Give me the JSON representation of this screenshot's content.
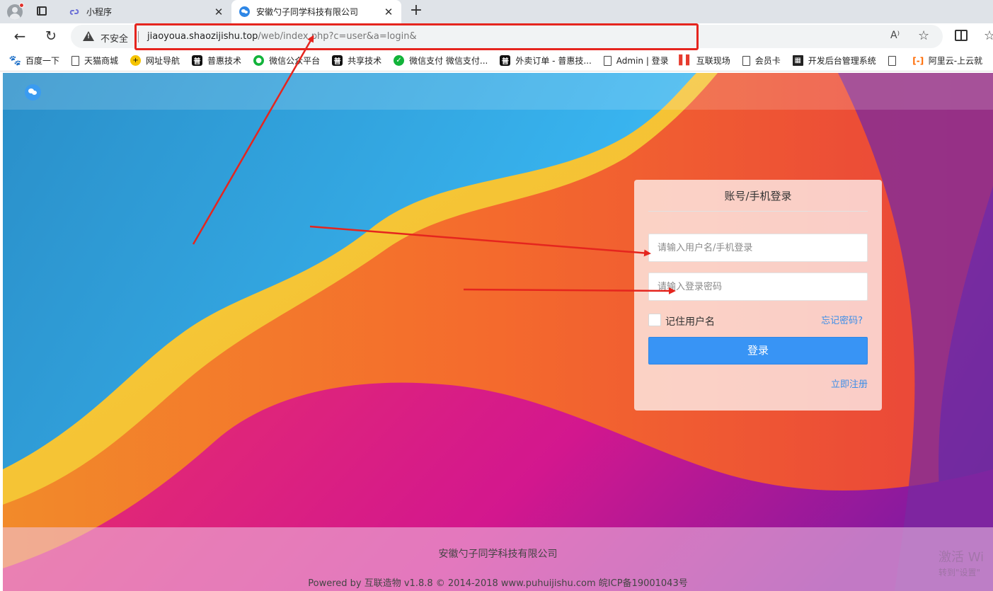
{
  "browser": {
    "tabs": [
      {
        "title": "小程序",
        "close": "✕"
      },
      {
        "title": "安徽勺子同学科技有限公司",
        "close": "✕"
      }
    ],
    "new_tab": "+",
    "back": "←",
    "reload": "↻",
    "security_label": "不安全",
    "url_host": "jiaoyoua.shaozijishu.top",
    "url_path": "/web/index.php?c=user&a=login&",
    "read_aloud": "A⁾",
    "star": "☆"
  },
  "bookmarks": [
    {
      "label": "百度一下",
      "icon": "paw-icon"
    },
    {
      "label": "天猫商城",
      "icon": "page-icon"
    },
    {
      "label": "网址导航",
      "icon": "nav-icon"
    },
    {
      "label": "普惠技术",
      "icon": "puhui-icon"
    },
    {
      "label": "微信公众平台",
      "icon": "wechat-icon"
    },
    {
      "label": "共享技术",
      "icon": "puhui-icon"
    },
    {
      "label": "微信支付 微信支付...",
      "icon": "wechat-pay-icon"
    },
    {
      "label": "外卖订单 - 普惠技...",
      "icon": "puhui-icon"
    },
    {
      "label": "Admin | 登录",
      "icon": "page-icon"
    },
    {
      "label": "互联现场",
      "icon": "bars-icon"
    },
    {
      "label": "会员卡",
      "icon": "page-icon"
    },
    {
      "label": "开发后台管理系统",
      "icon": "qr-icon"
    },
    {
      "label": "",
      "icon": "page-icon"
    },
    {
      "label": "阿里云-上云就",
      "icon": "aliyun-icon"
    }
  ],
  "login": {
    "title": "账号/手机登录",
    "username_placeholder": "请输入用户名/手机登录",
    "password_placeholder": "请输入登录密码",
    "remember_label": "记住用户名",
    "forgot_label": "忘记密码?",
    "login_button": "登录",
    "register_label": "立即注册"
  },
  "footer": {
    "company": "安徽勺子同学科技有限公司",
    "powered": "Powered by 互联造物 v1.8.8 © 2014-2018 www.puhuijishu.com 皖ICP备19001043号"
  },
  "watermark": {
    "line1": "激活 Wi",
    "line2": "转到\"设置\""
  },
  "colors": {
    "accent_blue": "#3894f5",
    "annotation_red": "#e5251e"
  }
}
